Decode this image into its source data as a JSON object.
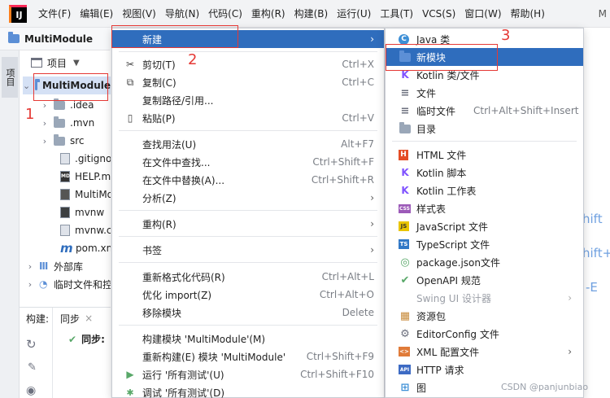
{
  "menubar": {
    "logo": "IJ",
    "items": [
      "文件(F)",
      "编辑(E)",
      "视图(V)",
      "导航(N)",
      "代码(C)",
      "重构(R)",
      "构建(B)",
      "运行(U)",
      "工具(T)",
      "VCS(S)",
      "窗口(W)",
      "帮助(H)"
    ],
    "tail": "M"
  },
  "breadcrumb": {
    "project": "MultiModule"
  },
  "toolstrip": {
    "project_tab": "项目"
  },
  "project_panel": {
    "header": "项目",
    "tree": [
      {
        "label": "MultiModule",
        "selected": true
      },
      {
        "label": ".idea"
      },
      {
        "label": ".mvn"
      },
      {
        "label": "src"
      },
      {
        "label": ".gitignore"
      },
      {
        "label": "HELP.md"
      },
      {
        "label": "MultiModule.iml"
      },
      {
        "label": "mvnw"
      },
      {
        "label": "mvnw.cmd"
      },
      {
        "label": "pom.xml"
      },
      {
        "label": "外部库"
      },
      {
        "label": "临时文件和控制台"
      }
    ]
  },
  "build_panel": {
    "label": "构建:",
    "tab": "同步",
    "close": "×",
    "sync_item": "同步:"
  },
  "context_menu": {
    "items": [
      {
        "label": "新建",
        "shortcut": "",
        "arrow": "›",
        "active": true,
        "icon": ""
      },
      {
        "label": "剪切(T)",
        "shortcut": "Ctrl+X",
        "icon": "✂"
      },
      {
        "label": "复制(C)",
        "shortcut": "Ctrl+C",
        "icon": "⧉"
      },
      {
        "label": "复制路径/引用...",
        "shortcut": "",
        "icon": ""
      },
      {
        "label": "粘贴(P)",
        "shortcut": "Ctrl+V",
        "icon": "📋"
      },
      {
        "label": "查找用法(U)",
        "shortcut": "Alt+F7",
        "icon": ""
      },
      {
        "label": "在文件中查找...",
        "shortcut": "Ctrl+Shift+F",
        "icon": ""
      },
      {
        "label": "在文件中替换(A)...",
        "shortcut": "Ctrl+Shift+R",
        "icon": ""
      },
      {
        "label": "分析(Z)",
        "shortcut": "",
        "arrow": "›",
        "icon": ""
      },
      {
        "label": "重构(R)",
        "shortcut": "",
        "arrow": "›",
        "icon": ""
      },
      {
        "label": "书签",
        "shortcut": "",
        "arrow": "›",
        "icon": ""
      },
      {
        "label": "重新格式化代码(R)",
        "shortcut": "Ctrl+Alt+L",
        "icon": ""
      },
      {
        "label": "优化 import(Z)",
        "shortcut": "Ctrl+Alt+O",
        "icon": ""
      },
      {
        "label": "移除模块",
        "shortcut": "Delete",
        "icon": ""
      },
      {
        "label": "构建模块 'MultiModule'(M)",
        "shortcut": "",
        "icon": ""
      },
      {
        "label": "重新构建(E) 模块 'MultiModule'",
        "shortcut": "Ctrl+Shift+F9",
        "icon": ""
      },
      {
        "label": "运行 '所有测试'(U)",
        "shortcut": "Ctrl+Shift+F10",
        "icon": "▶"
      },
      {
        "label": "调试 '所有测试'(D)",
        "shortcut": "",
        "icon": "🐞"
      }
    ]
  },
  "submenu": {
    "items": [
      {
        "label": "Java 类",
        "icon": "C",
        "icon_color": "#3d8fd6"
      },
      {
        "label": "新模块",
        "icon": "▬",
        "icon_color": "#5c8fd6",
        "active": true
      },
      {
        "label": "Kotlin 类/文件",
        "icon": "K",
        "icon_color": "#7f52ff"
      },
      {
        "label": "文件",
        "icon": "≡",
        "icon_color": "#6c707e"
      },
      {
        "label": "临时文件",
        "shortcut": "Ctrl+Alt+Shift+Insert",
        "icon": "≡",
        "icon_color": "#6c707e"
      },
      {
        "label": "目录",
        "icon": "▬",
        "icon_color": "#9aa7b8"
      },
      {
        "label": "HTML 文件",
        "icon": "H",
        "icon_color": "#e44d26"
      },
      {
        "label": "Kotlin 脚本",
        "icon": "K",
        "icon_color": "#7f52ff"
      },
      {
        "label": "Kotlin 工作表",
        "icon": "K",
        "icon_color": "#7f52ff"
      },
      {
        "label": "样式表",
        "icon": "CSS",
        "icon_color": "#9c5ab8"
      },
      {
        "label": "JavaScript 文件",
        "icon": "JS",
        "icon_color": "#e9c500"
      },
      {
        "label": "TypeScript 文件",
        "icon": "TS",
        "icon_color": "#3178c6"
      },
      {
        "label": "package.json文件",
        "icon": "◎",
        "icon_color": "#59a869"
      },
      {
        "label": "OpenAPI 规范",
        "icon": "✔",
        "icon_color": "#59a869"
      },
      {
        "label": "Swing UI 设计器",
        "icon": "",
        "arrow": "›",
        "disabled": true
      },
      {
        "label": "资源包",
        "icon": "▦",
        "icon_color": "#c78a3a"
      },
      {
        "label": "EditorConfig 文件",
        "icon": "⚙",
        "icon_color": "#6c707e"
      },
      {
        "label": "XML 配置文件",
        "icon": "<>",
        "icon_color": "#e07b39",
        "arrow": "›"
      },
      {
        "label": "HTTP 请求",
        "icon": "API",
        "icon_color": "#3d6bc4"
      },
      {
        "label": "图",
        "icon": "⊞",
        "icon_color": "#3d8fd6"
      }
    ]
  },
  "editor_fragments": [
    "hift",
    "hift+",
    "-E"
  ],
  "annotations": [
    "1",
    "2",
    "3"
  ],
  "colors": {
    "selection": "#2f6dbd",
    "annotation": "#e53935",
    "menu_bg": "#ffffff"
  },
  "watermark": "CSDN @panjunbiao"
}
